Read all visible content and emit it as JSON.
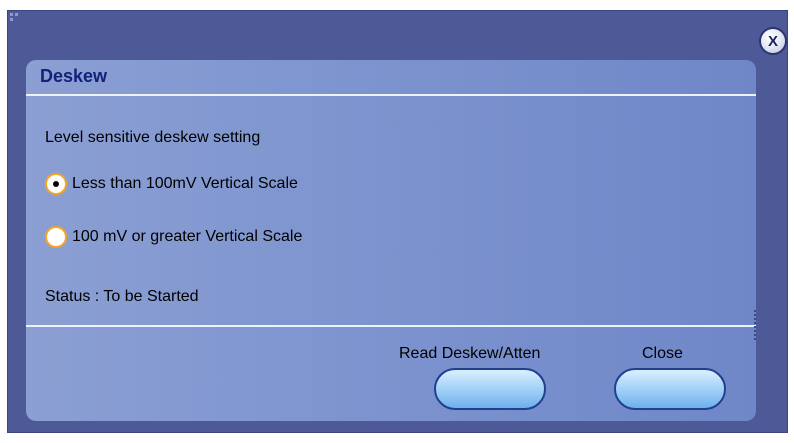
{
  "dialog": {
    "title": "Deskew",
    "close_icon_label": "X",
    "section_label": "Level sensitive deskew setting",
    "options": [
      {
        "label": "Less than 100mV Vertical Scale",
        "selected": true
      },
      {
        "label": "100 mV or greater Vertical Scale",
        "selected": false
      }
    ],
    "status": "Status : To be Started",
    "buttons": {
      "read_label": "Read Deskew/Atten",
      "close_label": "Close"
    }
  },
  "colors": {
    "window_bg": "#4d5a97",
    "title": "#15207a",
    "radio_ring": "#f5a623",
    "button_fill": "#a8d4f8"
  }
}
